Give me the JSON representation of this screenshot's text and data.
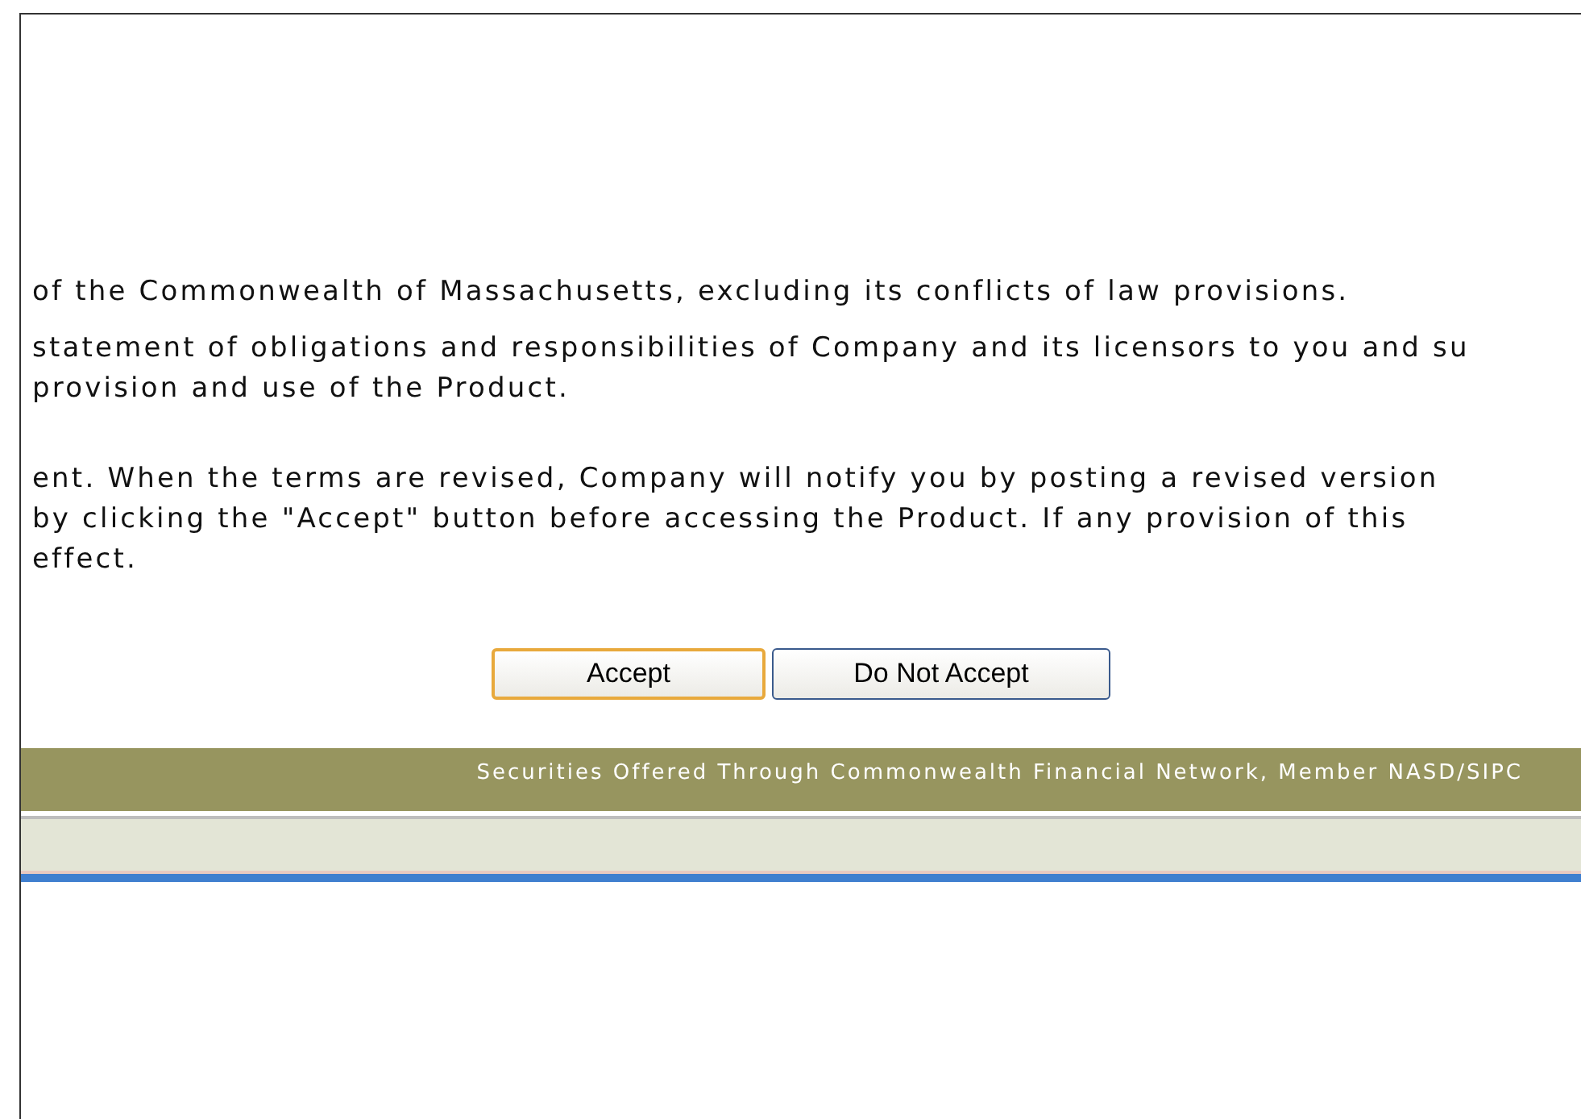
{
  "paragraphs": [
    [
      "of the Commonwealth of Massachusetts, excluding its conflicts of law provisions."
    ],
    [
      "statement of obligations and responsibilities of Company and its licensors to you and su",
      "provision and use of the Product."
    ],
    [
      "ent. When the terms are revised, Company will notify you by posting a revised version",
      "by clicking the \"Accept\" button before accessing the Product. If any provision of this",
      "effect."
    ]
  ],
  "buttons": [
    {
      "label": "Accept",
      "selected": true
    },
    {
      "label": "Do Not Accept",
      "selected": false
    }
  ],
  "footer": {
    "text": "Securities Offered Through Commonwealth Financial Network, Member NASD/SIPC"
  }
}
